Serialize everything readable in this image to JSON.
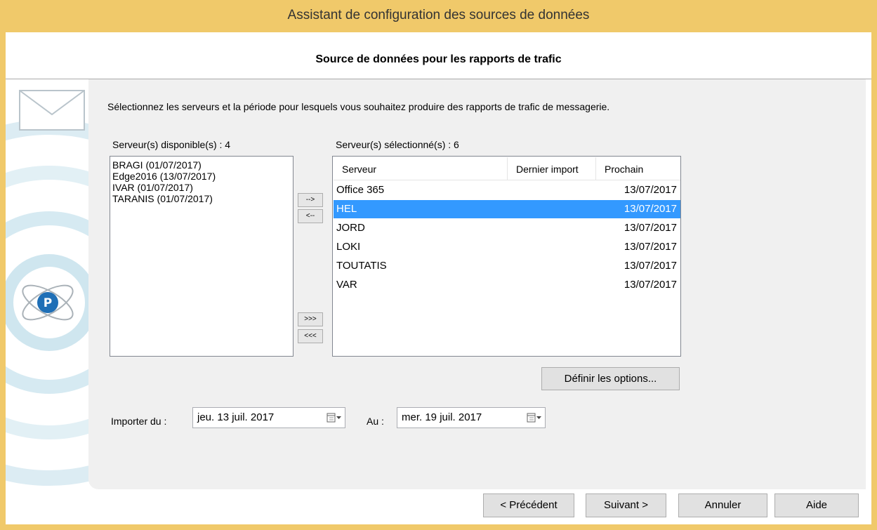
{
  "window": {
    "title": "Assistant de configuration des sources de données"
  },
  "page": {
    "header": "Source de données pour les rapports de trafic",
    "instruction": "Sélectionnez les serveurs et la période pour lesquels vous souhaitez produire des rapports de trafic de messagerie."
  },
  "available": {
    "label": "Serveur(s) disponible(s) : 4",
    "items": [
      "BRAGI (01/07/2017)",
      "Edge2016 (13/07/2017)",
      "IVAR (01/07/2017)",
      "TARANIS (01/07/2017)"
    ]
  },
  "transfer": {
    "add": "-->",
    "remove": "<--",
    "add_all": ">>>",
    "remove_all": "<<<"
  },
  "selected": {
    "label": "Serveur(s) sélectionné(s) : 6",
    "columns": {
      "server": "Serveur",
      "last_import": "Dernier import",
      "next": "Prochain"
    },
    "rows": [
      {
        "server": "Office 365",
        "last_import": "",
        "next": "13/07/2017"
      },
      {
        "server": "HEL",
        "last_import": "",
        "next": "13/07/2017",
        "selected": true
      },
      {
        "server": "JORD",
        "last_import": "",
        "next": "13/07/2017"
      },
      {
        "server": "LOKI",
        "last_import": "",
        "next": "13/07/2017"
      },
      {
        "server": "TOUTATIS",
        "last_import": "",
        "next": "13/07/2017"
      },
      {
        "server": "VAR",
        "last_import": "",
        "next": "13/07/2017"
      }
    ]
  },
  "options_button": "Définir les options...",
  "import": {
    "from_label": "Importer du :",
    "from_value": "jeu. 13 juil. 2017",
    "to_label": "Au :",
    "to_value": "mer. 19 juil. 2017"
  },
  "footer": {
    "previous": "< Précédent",
    "next": "Suivant >",
    "cancel": "Annuler",
    "help": "Aide"
  },
  "colors": {
    "title_bar": "#f0c96a",
    "selection": "#3399ff",
    "panel": "#f0f0f0"
  },
  "icons": {
    "sidebar_logo": "envelope-and-logo-icon",
    "calendar": "calendar-dropdown-icon"
  }
}
